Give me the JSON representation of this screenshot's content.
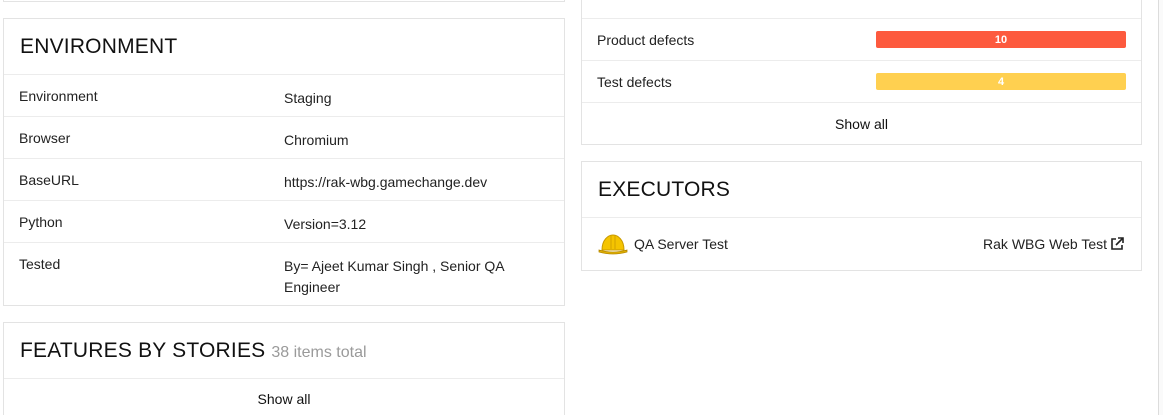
{
  "environment": {
    "title": "ENVIRONMENT",
    "rows": [
      {
        "key": "Environment",
        "value": "Staging"
      },
      {
        "key": "Browser",
        "value": "Chromium"
      },
      {
        "key": "BaseURL",
        "value": "https://rak-wbg.gamechange.dev"
      },
      {
        "key": "Python",
        "value": "Version=3.12"
      },
      {
        "key": "Tested",
        "value": "By= Ajeet Kumar Singh , Senior QA Engineer"
      }
    ]
  },
  "features": {
    "title": "FEATURES BY STORIES",
    "subtitle": "38 items total",
    "show_all": "Show all"
  },
  "defects": {
    "rows": [
      {
        "label": "Product defects",
        "count": "10",
        "fill": 1.0,
        "color": "#fd5a3e"
      },
      {
        "label": "Test defects",
        "count": "4",
        "fill": 1.0,
        "color": "#ffd050"
      }
    ],
    "show_all": "Show all"
  },
  "executors": {
    "title": "EXECUTORS",
    "name": "QA Server Test",
    "icon": "hard-hat-icon",
    "link_text": "Rak WBG Web Test",
    "link_icon": "external-link-icon"
  }
}
